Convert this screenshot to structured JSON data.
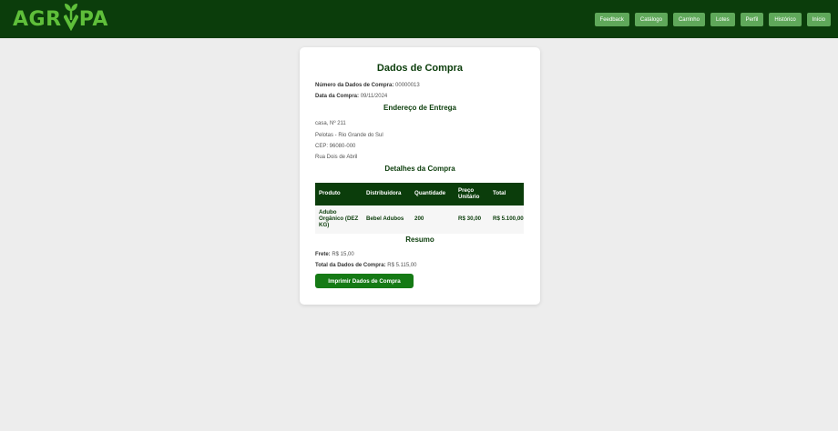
{
  "brand": {
    "logo_text": "AGROPA",
    "logo_part1": "AGR",
    "logo_part2": "PA"
  },
  "nav": [
    "Feedback",
    "Catálogo",
    "Carrinho",
    "Lotes",
    "Perfil",
    "Histórico",
    "Início"
  ],
  "purchase": {
    "title": "Dados de Compra",
    "number_label": "Número da Dados de Compra:",
    "number_value": "00000013",
    "date_label": "Data da Compra:",
    "date_value": "09/11/2024"
  },
  "address": {
    "heading": "Endereço de Entrega",
    "line1": "casa, Nº 211",
    "line2": "Pelotas - Rio Grande do Sul",
    "line3": "CEP: 96080-000",
    "line4": "Rua Dois de Abril"
  },
  "details": {
    "heading": "Detalhes da Compra",
    "columns": [
      "Produto",
      "Distribuidora",
      "Quantidade",
      "Preço Unitário",
      "Total"
    ],
    "rows": [
      {
        "produto": "Adubo Orgânico (DEZ KG)",
        "distribuidora": "Bebel Adubos",
        "quantidade": "200",
        "preco": "R$ 30,00",
        "total": "R$ 5.100,00"
      }
    ]
  },
  "summary": {
    "heading": "Resumo",
    "frete_label": "Frete:",
    "frete_value": "R$ 15,00",
    "total_label": "Total da Dados de Compra:",
    "total_value": "R$ 5.115,00",
    "print_button": "Imprimir Dados de Compra"
  },
  "colors": {
    "header_bg": "#0b3d0b",
    "nav_button": "#5fa85a",
    "logo": "#5fbf3a",
    "primary_button": "#157a15",
    "page_bg": "#ededed"
  },
  "icons": {
    "logo_mark": "sprout-icon"
  }
}
